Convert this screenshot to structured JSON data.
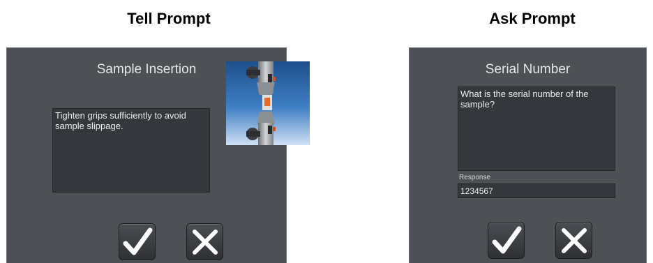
{
  "tell": {
    "caption": "Tell Prompt",
    "title": "Sample Insertion",
    "message": "Tighten grips sufficiently to avoid sample slippage.",
    "image_icon": "grip-sample-photo",
    "ok_icon": "checkmark-icon",
    "cancel_icon": "close-icon"
  },
  "ask": {
    "caption": "Ask Prompt",
    "title": "Serial Number",
    "message": "What is the serial number of the sample?",
    "response_label": "Response",
    "response_value": "1234567",
    "ok_icon": "checkmark-icon",
    "cancel_icon": "close-icon"
  },
  "colors": {
    "panel_bg": "#4d5054",
    "textbox_bg": "#34373c",
    "icon_white": "#ffffff"
  }
}
